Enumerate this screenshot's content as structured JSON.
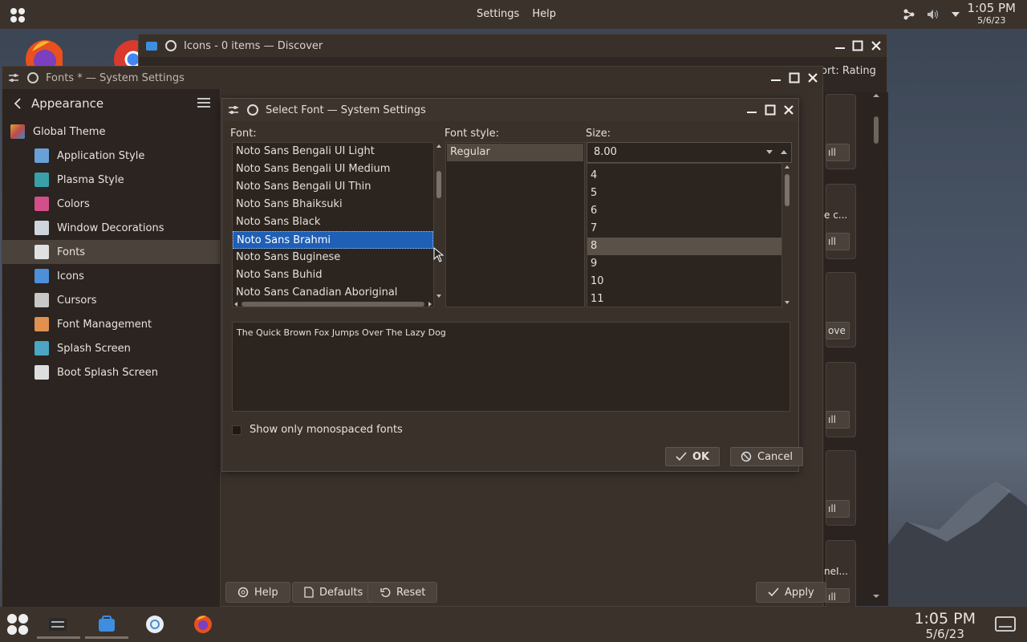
{
  "topbar": {
    "menu": [
      "Settings",
      "Help"
    ],
    "clock_time": "1:05 PM",
    "clock_date": "5/6/23",
    "icons": [
      "apps-grid-icon",
      "network-icon",
      "volume-icon",
      "chevron-down-icon"
    ]
  },
  "discover": {
    "title": "Icons - 0 items — Discover",
    "sort_label": "ort: Rating",
    "cards": [
      {
        "button": "ıll"
      },
      {
        "partial_text": "e c...",
        "button": "ıll"
      },
      {
        "button": "ove"
      },
      {
        "button": "ıll"
      },
      {
        "button": "ıll"
      },
      {
        "partial_text": "neI...",
        "button": "ıll"
      }
    ]
  },
  "settings": {
    "title": "Fonts * — System Settings",
    "section": "Appearance",
    "items": [
      {
        "label": "Global Theme",
        "icon": "global-theme-icon",
        "color": "#d7a23a"
      },
      {
        "label": "Application Style",
        "icon": "application-style-icon",
        "color": "#6aa0d8"
      },
      {
        "label": "Plasma Style",
        "icon": "plasma-style-icon",
        "color": "#3aa0a8"
      },
      {
        "label": "Colors",
        "icon": "colors-icon",
        "color": "#d34f8c"
      },
      {
        "label": "Window Decorations",
        "icon": "window-decorations-icon",
        "color": "#cfd5dc"
      },
      {
        "label": "Fonts",
        "icon": "fonts-icon",
        "color": "#e0e0e0"
      },
      {
        "label": "Icons",
        "icon": "icons-icon",
        "color": "#4d8fd8"
      },
      {
        "label": "Cursors",
        "icon": "cursors-icon",
        "color": "#c8c8c8"
      },
      {
        "label": "Font Management",
        "icon": "font-management-icon",
        "color": "#e09050"
      },
      {
        "label": "Splash Screen",
        "icon": "splash-screen-icon",
        "color": "#4ca5c5"
      },
      {
        "label": "Boot Splash Screen",
        "icon": "boot-splash-screen-icon",
        "color": "#dddddd"
      }
    ],
    "selected": "Fonts",
    "buttons": {
      "help": "Help",
      "defaults": "Defaults",
      "reset": "Reset",
      "apply": "Apply"
    }
  },
  "dialog": {
    "title": "Select Font — System Settings",
    "font_label": "Font:",
    "style_label": "Font style:",
    "size_label": "Size:",
    "fonts": [
      "Noto Sans Bengali UI Light",
      "Noto Sans Bengali UI Medium",
      "Noto Sans Bengali UI Thin",
      "Noto Sans Bhaiksuki",
      "Noto Sans Black",
      "Noto Sans Brahmi",
      "Noto Sans Buginese",
      "Noto Sans Buhid",
      "Noto Sans Canadian Aboriginal"
    ],
    "selected_font": "Noto Sans Brahmi",
    "styles": [
      "Regular"
    ],
    "size_value": "8.00",
    "sizes": [
      "4",
      "5",
      "6",
      "7",
      "8",
      "9",
      "10",
      "11"
    ],
    "selected_size": "8",
    "preview_text": "The Quick Brown Fox Jumps Over The Lazy Dog",
    "monospace_label": "Show only monospaced fonts",
    "ok": "OK",
    "cancel": "Cancel",
    "accent": "#1f5fb5"
  },
  "taskbar": {
    "clock_time": "1:05 PM",
    "clock_date": "5/6/23",
    "items": [
      "application-launcher-icon",
      "system-settings-icon",
      "discover-icon",
      "steam-icon",
      "firefox-icon",
      "show-desktop-icon"
    ]
  }
}
